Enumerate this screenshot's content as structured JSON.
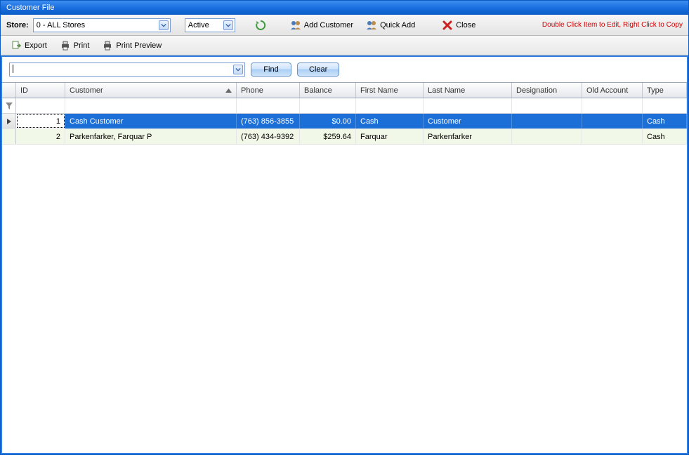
{
  "window": {
    "title": "Customer File"
  },
  "toolbar1": {
    "store_label": "Store:",
    "store_value": "0 - ALL Stores",
    "status_value": "Active",
    "add_customer": "Add Customer",
    "quick_add": "Quick Add",
    "close": "Close",
    "hint": "Double Click Item to Edit, Right Click to Copy"
  },
  "toolbar2": {
    "export": "Export",
    "print": "Print",
    "print_preview": "Print Preview"
  },
  "search": {
    "value": "",
    "find": "Find",
    "clear": "Clear"
  },
  "grid": {
    "headers": {
      "id": "ID",
      "customer": "Customer",
      "phone": "Phone",
      "balance": "Balance",
      "first_name": "First Name",
      "last_name": "Last Name",
      "designation": "Designation",
      "old_account": "Old Account",
      "type": "Type"
    },
    "rows": [
      {
        "id": "1",
        "customer": "Cash Customer",
        "phone": "(763) 856-3855",
        "balance": "$0.00",
        "first_name": "Cash",
        "last_name": "Customer",
        "designation": "",
        "old_account": "",
        "type": "Cash",
        "selected": true
      },
      {
        "id": "2",
        "customer": "Parkenfarker, Farquar P",
        "phone": "(763) 434-9392",
        "balance": "$259.64",
        "first_name": "Farquar",
        "last_name": "Parkenfarker",
        "designation": "",
        "old_account": "",
        "type": "Cash",
        "selected": false
      }
    ]
  }
}
